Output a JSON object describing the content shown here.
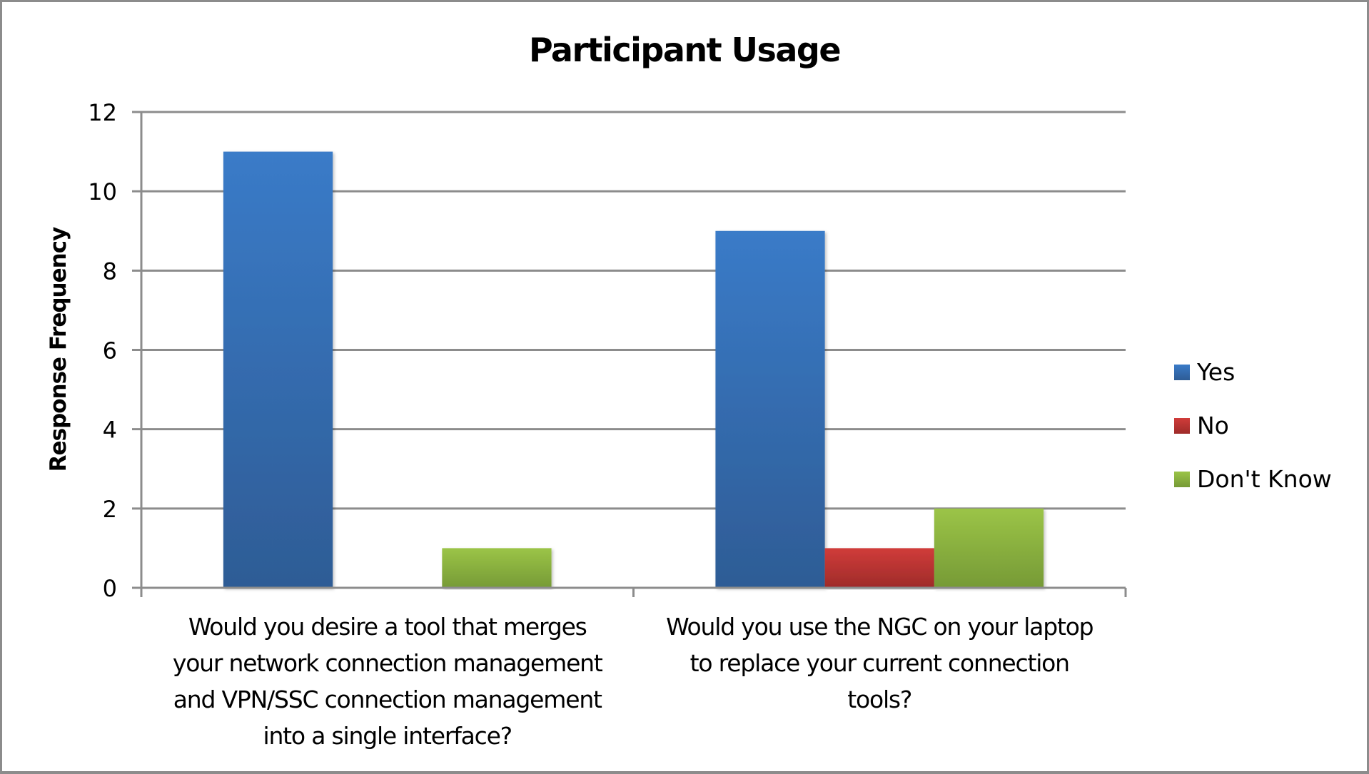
{
  "chart_data": {
    "type": "bar",
    "title": "Participant Usage",
    "xlabel": "",
    "ylabel": "Response Frequency",
    "ylim": [
      0,
      12
    ],
    "yticks": [
      0,
      2,
      4,
      6,
      8,
      10,
      12
    ],
    "grid": true,
    "legend_position": "right",
    "categories": [
      "Would you desire a tool that merges your network connection management and VPN/SSC connection management into a single interface?",
      "Would you use the NGC on your laptop to replace your current connection tools?"
    ],
    "category_lines": [
      [
        "Would you desire a tool that merges",
        "your network connection management",
        "and VPN/SSC connection management",
        "into a single interface?"
      ],
      [
        "Would you use the NGC on your laptop",
        "to replace your current connection",
        "tools?"
      ]
    ],
    "series": [
      {
        "name": "Yes",
        "values": [
          11,
          9
        ],
        "color": "#3a7bc8",
        "color_dark": "#2e5c95"
      },
      {
        "name": "No",
        "values": [
          0,
          1
        ],
        "color": "#d03c3a",
        "color_dark": "#9e2b29"
      },
      {
        "name": "Don't Know",
        "values": [
          1,
          2
        ],
        "color": "#9bc447",
        "color_dark": "#769a36"
      }
    ]
  }
}
